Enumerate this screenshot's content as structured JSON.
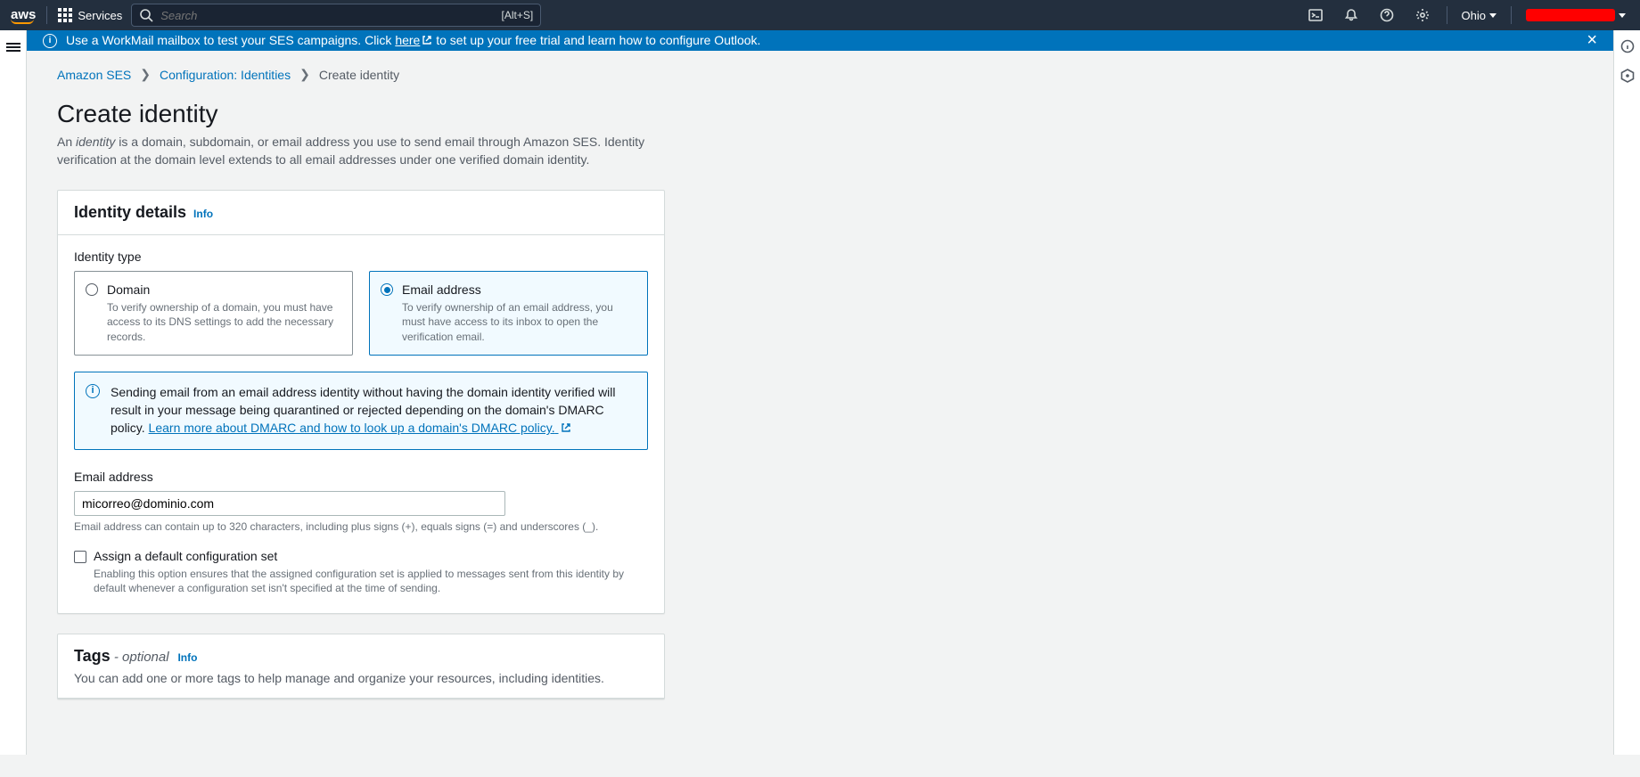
{
  "nav": {
    "services_label": "Services",
    "search_placeholder": "Search",
    "search_shortcut": "[Alt+S]",
    "region": "Ohio"
  },
  "banner": {
    "prefix": "Use a WorkMail mailbox to test your SES campaigns. Click ",
    "link": "here",
    "suffix": " to set up your free trial and learn how to configure Outlook."
  },
  "breadcrumb": {
    "root": "Amazon SES",
    "mid": "Configuration: Identities",
    "current": "Create identity"
  },
  "page": {
    "title": "Create identity",
    "desc_pre": "An ",
    "desc_em": "identity",
    "desc_post": " is a domain, subdomain, or email address you use to send email through Amazon SES. Identity verification at the domain level extends to all email addresses under one verified domain identity."
  },
  "identity_panel": {
    "title": "Identity details",
    "info": "Info",
    "type_label": "Identity type",
    "domain": {
      "title": "Domain",
      "desc": "To verify ownership of a domain, you must have access to its DNS settings to add the necessary records."
    },
    "email": {
      "title": "Email address",
      "desc": "To verify ownership of an email address, you must have access to its inbox to open the verification email."
    },
    "alert_text": "Sending email from an email address identity without having the domain identity verified will result in your message being quarantined or rejected depending on the domain's DMARC policy. ",
    "alert_link": "Learn more about DMARC and how to look up a domain's DMARC policy.",
    "email_label": "Email address",
    "email_value": "micorreo@dominio.com",
    "email_hint": "Email address can contain up to 320 characters, including plus signs (+), equals signs (=) and underscores (_).",
    "config_label": "Assign a default configuration set",
    "config_hint": "Enabling this option ensures that the assigned configuration set is applied to messages sent from this identity by default whenever a configuration set isn't specified at the time of sending."
  },
  "tags_panel": {
    "title": "Tags",
    "optional": " - optional",
    "info": "Info",
    "desc": "You can add one or more tags to help manage and organize your resources, including identities."
  }
}
